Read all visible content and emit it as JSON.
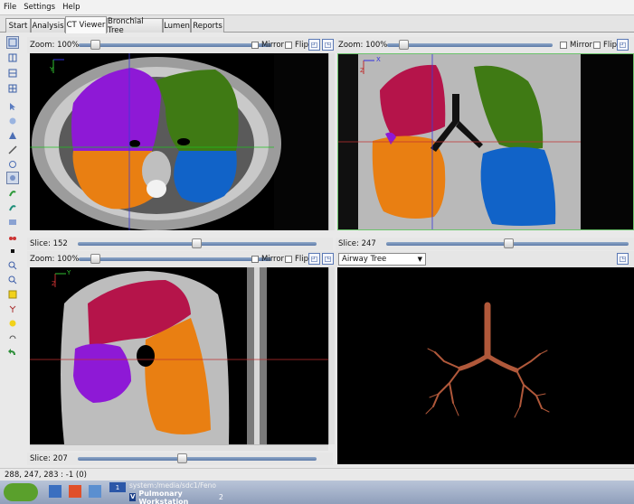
{
  "menu": [
    "File",
    "Settings",
    "Help"
  ],
  "tabs": [
    {
      "label": "Start",
      "active": false
    },
    {
      "label": "Analysis",
      "active": false
    },
    {
      "label": "CT Viewer",
      "active": true
    },
    {
      "label": "Bronchial Tree",
      "active": false
    },
    {
      "label": "Lumen",
      "active": false
    },
    {
      "label": "Reports",
      "active": false
    }
  ],
  "views": {
    "axial": {
      "zoom_label": "Zoom: 100%",
      "mirror_label": "Mirror",
      "flip_label": "Flip",
      "slice_label": "Slice: 152"
    },
    "coronal": {
      "zoom_label": "Zoom: 100%",
      "mirror_label": "Mirror",
      "flip_label": "Flip",
      "slice_label": "Slice: 247"
    },
    "sagittal": {
      "zoom_label": "Zoom: 100%",
      "mirror_label": "Mirror",
      "flip_label": "Flip",
      "slice_label": "Slice: 207"
    },
    "tree": {
      "dropdown_value": "Airway Tree"
    }
  },
  "axis_labels": {
    "x": "X",
    "y": "Y",
    "z": "Z"
  },
  "status": "288, 247, 283 : -1  (0)",
  "taskbar": {
    "path_text": "system:/media/sdc1/Feno",
    "window_title": "Pulmonary Workstation",
    "window_count": "2",
    "desktop_number": "1"
  },
  "colors": {
    "lobe_purple": "#8e19d6",
    "lobe_green": "#3f7a14",
    "lobe_orange": "#e97f12",
    "lobe_blue": "#1163c8",
    "lobe_red": "#b5144a",
    "airway": "#b0583a",
    "accent": "#5b79b5"
  }
}
